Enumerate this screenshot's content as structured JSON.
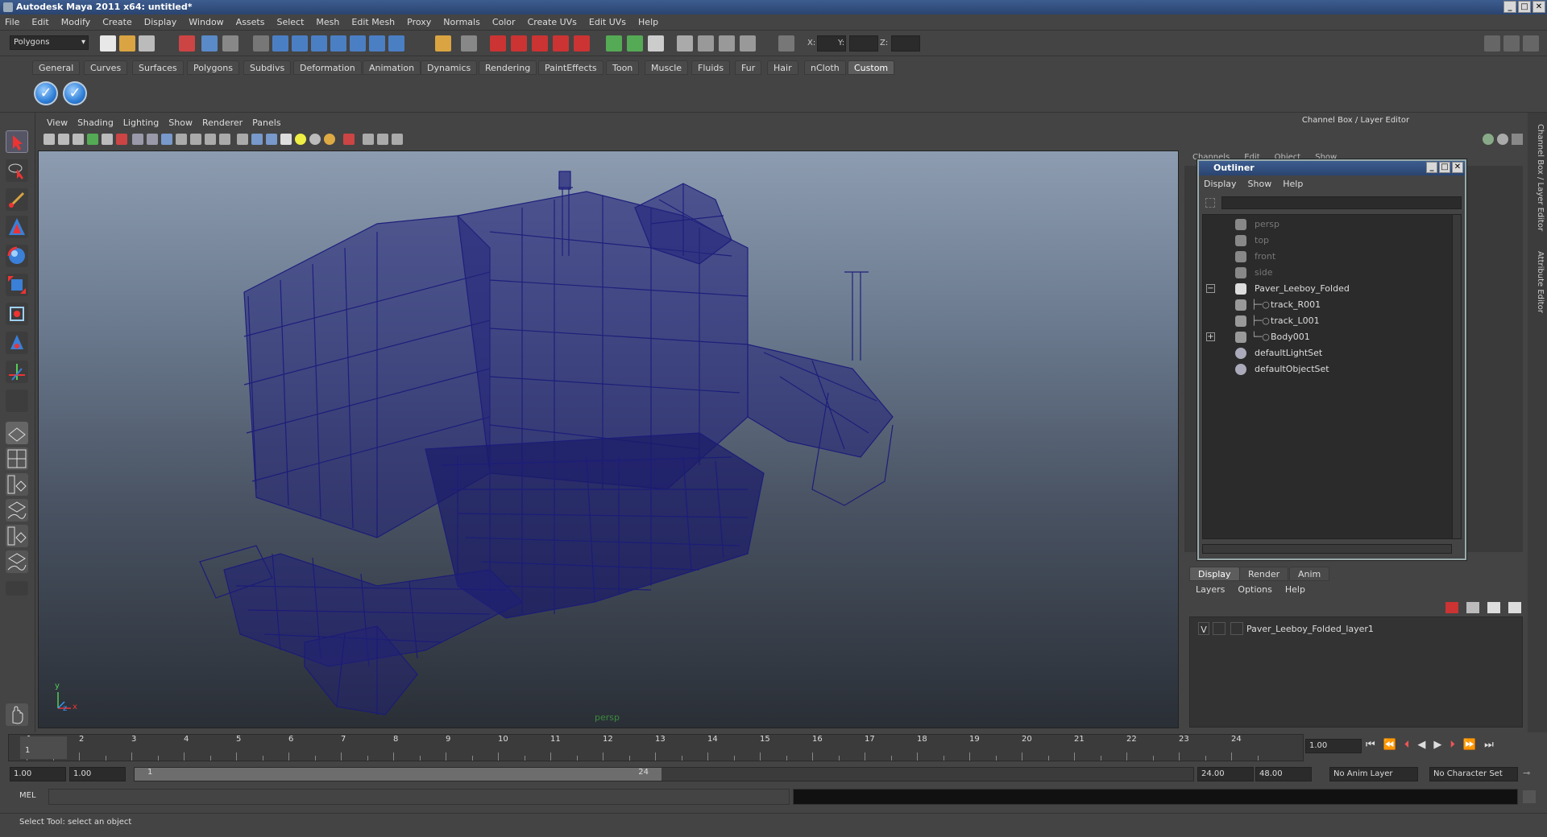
{
  "window": {
    "title": "Autodesk Maya 2011 x64: untitled*",
    "controls": [
      "_",
      "□",
      "✕"
    ]
  },
  "menubar": [
    "File",
    "Edit",
    "Modify",
    "Create",
    "Display",
    "Window",
    "Assets",
    "Select",
    "Mesh",
    "Edit Mesh",
    "Proxy",
    "Normals",
    "Color",
    "Create UVs",
    "Edit UVs",
    "Help"
  ],
  "statusline": {
    "mode": "Polygons",
    "x_label": "X:",
    "y_label": "Y:",
    "z_label": "Z:"
  },
  "shelf": {
    "tabs": [
      "General",
      "Curves",
      "Surfaces",
      "Polygons",
      "Subdivs",
      "Deformation",
      "Animation",
      "Dynamics",
      "Rendering",
      "PaintEffects",
      "Toon",
      "Muscle",
      "Fluids",
      "Fur",
      "Hair",
      "nCloth",
      "Custom"
    ],
    "active_tab": "Custom"
  },
  "viewport": {
    "menu": [
      "View",
      "Shading",
      "Lighting",
      "Show",
      "Renderer",
      "Panels"
    ],
    "camera_label": "persp",
    "axis_y": "y",
    "axis_x": "x",
    "axis_z": "z"
  },
  "channelbox": {
    "title": "Channel Box / Layer Editor",
    "menu": [
      "Channels",
      "Edit",
      "Object",
      "Show"
    ]
  },
  "outliner": {
    "title": "Outliner",
    "menu": [
      "Display",
      "Show",
      "Help"
    ],
    "items": [
      {
        "label": "persp",
        "dim": true
      },
      {
        "label": "top",
        "dim": true
      },
      {
        "label": "front",
        "dim": true
      },
      {
        "label": "side",
        "dim": true
      },
      {
        "label": "Paver_Leeboy_Folded",
        "dim": false
      },
      {
        "label": "track_R001",
        "dim": false
      },
      {
        "label": "track_L001",
        "dim": false
      },
      {
        "label": "Body001",
        "dim": false
      },
      {
        "label": "defaultLightSet",
        "dim": false
      },
      {
        "label": "defaultObjectSet",
        "dim": false
      }
    ]
  },
  "layers": {
    "tabs": [
      "Display",
      "Render",
      "Anim"
    ],
    "active_tab": "Display",
    "menu": [
      "Layers",
      "Options",
      "Help"
    ],
    "layer_visibility": "V",
    "layer_name": "Paver_Leeboy_Folded_layer1"
  },
  "side_tabs": [
    "Channel Box / Layer Editor",
    "Attribute Editor"
  ],
  "timeline": {
    "ticks": [
      "1",
      "2",
      "3",
      "4",
      "5",
      "6",
      "7",
      "8",
      "9",
      "10",
      "11",
      "12",
      "13",
      "14",
      "15",
      "16",
      "17",
      "18",
      "19",
      "20",
      "21",
      "22",
      "23",
      "24"
    ],
    "current_frame": "1",
    "current_frame_field": "1.00"
  },
  "range": {
    "start": "1.00",
    "start2": "1.00",
    "slider_start": "1",
    "slider_end": "24",
    "end": "24.00",
    "end2": "48.00",
    "anim_layer": "No Anim Layer",
    "character_set": "No Character Set"
  },
  "cmdline": {
    "label": "MEL"
  },
  "helpline": {
    "text": "Select Tool: select an object"
  }
}
